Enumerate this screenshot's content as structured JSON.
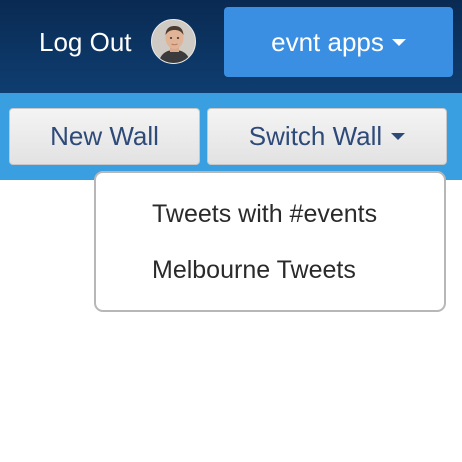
{
  "header": {
    "logout_label": "Log Out",
    "avatar_alt": "user avatar",
    "apps_label": "evnt apps"
  },
  "toolbar": {
    "new_wall_label": "New Wall",
    "switch_wall_label": "Switch Wall"
  },
  "switch_menu": {
    "items": [
      {
        "label": "Tweets with #events"
      },
      {
        "label": "Melbourne Tweets"
      }
    ]
  },
  "colors": {
    "topbar": "#0c3563",
    "accent_button": "#3a8fe3",
    "subbar": "#3a9fe0",
    "button_text": "#2e4a78"
  },
  "icons": {
    "apps_caret": "caret-down-icon",
    "switch_caret": "caret-down-icon"
  }
}
